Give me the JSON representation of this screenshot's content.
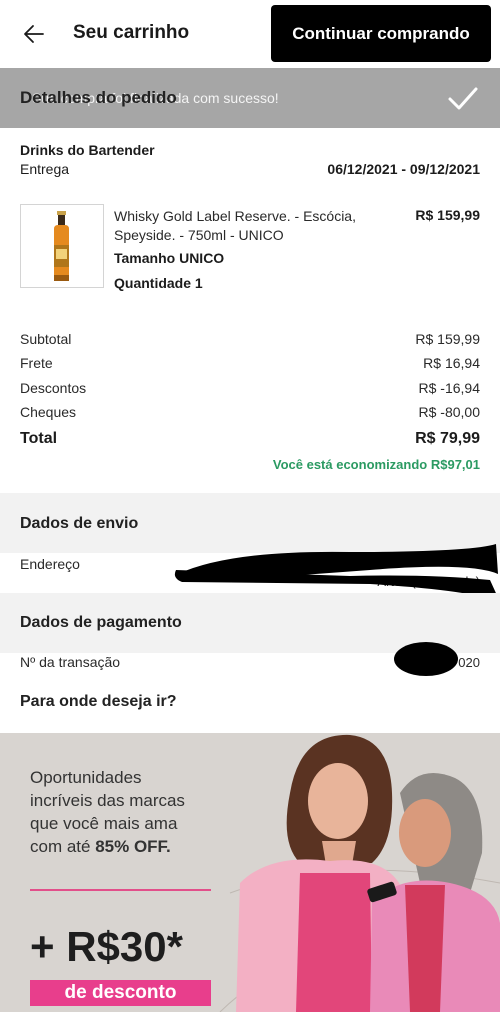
{
  "header": {
    "title": "Seu carrinho",
    "continue_label": "Continuar comprando"
  },
  "toast": {
    "message": "Sua compra foi finalizada com sucesso!"
  },
  "order": {
    "title": "Detalhes do pedido",
    "store": "Drinks do Bartender",
    "delivery_label": "Entrega",
    "delivery_dates": "06/12/2021 - 09/12/2021",
    "product": {
      "name": "Whisky Gold Label Reserve. - Escócia, Speyside. - 750ml - UNICO",
      "price": "R$ 159,99",
      "size": "Tamanho UNICO",
      "quantity": "Quantidade 1"
    }
  },
  "summary": {
    "rows": [
      {
        "label": "Subtotal",
        "value": "R$ 159,99"
      },
      {
        "label": "Frete",
        "value": "R$ 16,94"
      },
      {
        "label": "Descontos",
        "value": "R$ -16,94"
      },
      {
        "label": "Cheques",
        "value": "R$ -80,00"
      }
    ],
    "total_label": "Total",
    "total_value": "R$ 79,99",
    "savings": "Você está economizando R$97,01"
  },
  "shipping": {
    "title": "Dados de envio",
    "address_label": "Endereço",
    "address_value": "Artes (São Paulo)"
  },
  "payment": {
    "title": "Dados de pagamento",
    "transaction_label": "Nº da transação",
    "transaction_value": "020"
  },
  "navigate": {
    "title": "Para onde deseja ir?"
  },
  "banner": {
    "line1": "Oportunidades",
    "line2": "incríveis das marcas",
    "line3": "que você mais ama",
    "line4_prefix": "com até ",
    "line4_bold": "85% OFF.",
    "amount": "+ R$30*",
    "tag": "de desconto"
  },
  "colors": {
    "accent_green": "#2b9a62",
    "promo_pink": "#e83e8c",
    "button_black": "#000000",
    "overlay_gray": "#a6a6a6"
  }
}
